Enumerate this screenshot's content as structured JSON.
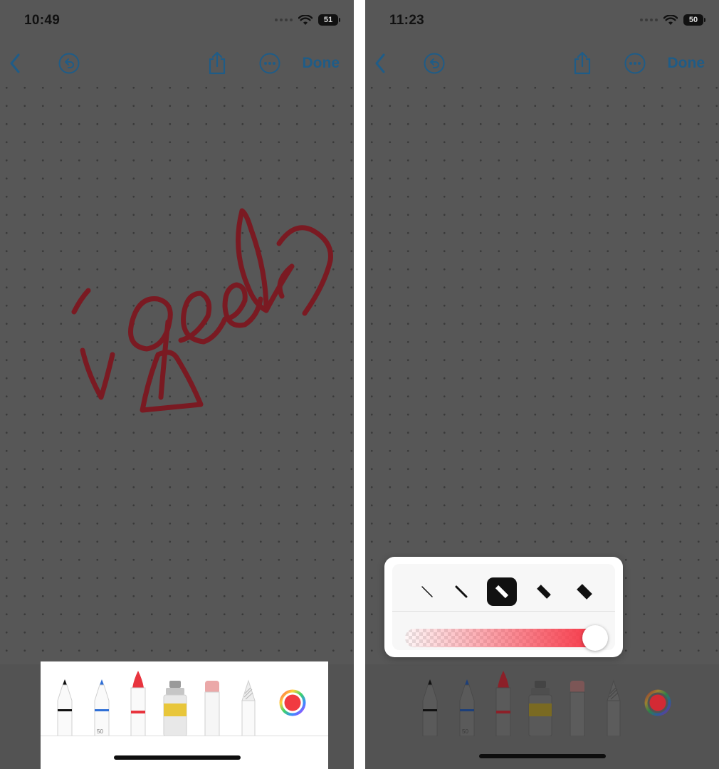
{
  "left_screen": {
    "status_bar": {
      "time": "10:49",
      "battery": "51"
    },
    "nav": {
      "done_label": "Done"
    },
    "drawing": {
      "handwriting_text": "igeeks",
      "ink_color": "#7a1a22"
    },
    "tool_picker": {
      "tools": [
        "pen-tool",
        "marker-tool",
        "crayon-tool",
        "watercolor-tool",
        "eraser-tool",
        "pencil-tool"
      ],
      "marker_label": "50",
      "selected_color": "#f13a40"
    }
  },
  "right_screen": {
    "status_bar": {
      "time": "11:23",
      "battery": "50"
    },
    "nav": {
      "done_label": "Done"
    },
    "width_popover": {
      "options": [
        "width-1",
        "width-2",
        "width-3",
        "width-4",
        "width-5"
      ],
      "selected_index": 2,
      "opacity_fraction": 1.0,
      "opacity_color": "#f63444"
    },
    "tool_picker": {
      "marker_label": "50",
      "selected_color": "#d42a34"
    }
  },
  "colors": {
    "accent_blue": "#1f5c87",
    "dim_overlay": "#575757"
  }
}
